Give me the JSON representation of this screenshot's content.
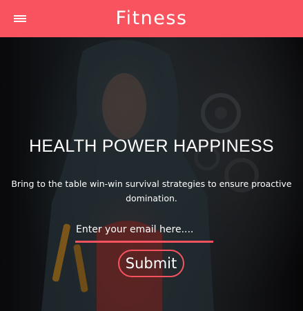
{
  "navbar": {
    "brand": "Fitness",
    "menu_icon": "hamburger-menu-icon",
    "background": "#f9535f"
  },
  "hero": {
    "headline": "HEALTH POWER HAPPINESS",
    "tagline": "Bring to the table win-win survival strategies to ensure proactive domination.",
    "email_placeholder": "Enter your email here....",
    "submit_label": "Submit",
    "accent_color": "#f9535f"
  }
}
